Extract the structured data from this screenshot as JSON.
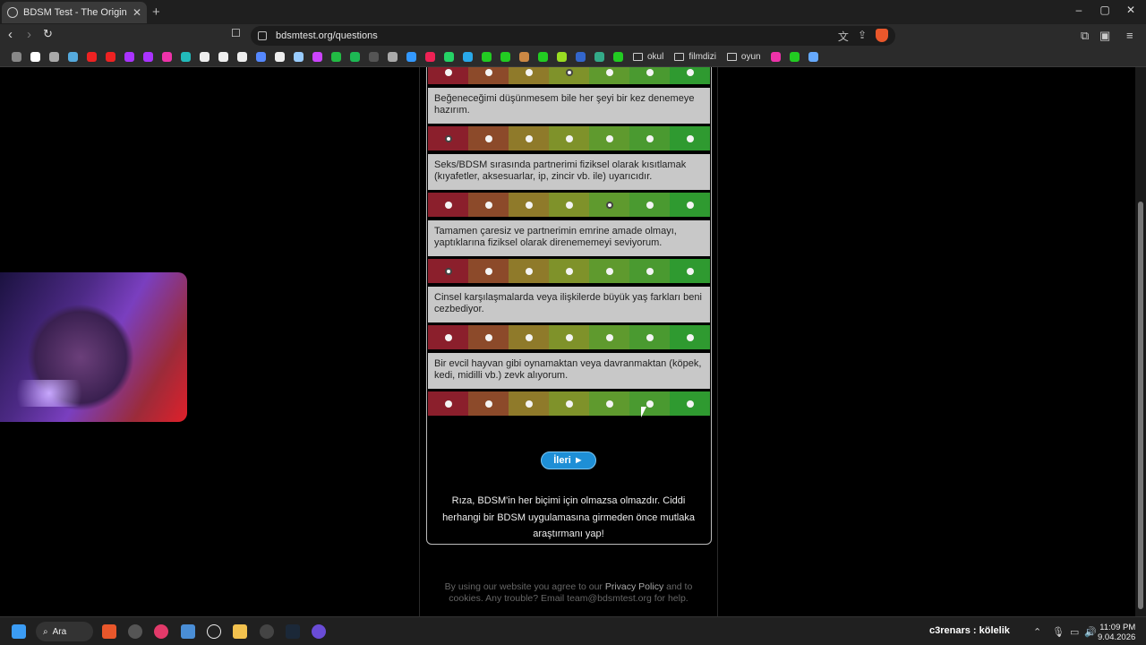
{
  "browser": {
    "tab_title": "BDSM Test - The Original BDSM",
    "new_tab": "+",
    "url": "bdsmtest.org/questions",
    "window_controls": [
      "–",
      "▢",
      "✕"
    ]
  },
  "bookmarks": {
    "folders": [
      "okul",
      "filmdizi",
      "oyun"
    ],
    "icon_colors": [
      "#888",
      "#fff",
      "#aaa",
      "#5ad",
      "#e22",
      "#e22",
      "#a3f",
      "#a3f",
      "#e3a",
      "#2bb",
      "#eee",
      "#eee",
      "#eee",
      "#58f",
      "#eee",
      "#9cf",
      "#c4f",
      "#2b4",
      "#1db954",
      "#555",
      "#aaa",
      "#39f",
      "#e25",
      "#25d366",
      "#29a9ea",
      "#2c2",
      "#2c2",
      "#c84",
      "#2c2",
      "#9d2",
      "#36c",
      "#3a8",
      "#2c2"
    ],
    "trailing_icon_colors": [
      "#e3a",
      "#2c2",
      "#6af"
    ]
  },
  "questions": [
    {
      "text": "",
      "selected": 3
    },
    {
      "text": "Beğeneceğimi düşünmesem bile her şeyi bir kez denemeye hazırım.",
      "selected": 0
    },
    {
      "text": "Seks/BDSM sırasında partnerimi fiziksel olarak kısıtlamak (kıyafetler, aksesuarlar, ip, zincir vb. ile) uyarıcıdır.",
      "selected": 4
    },
    {
      "text": "Tamamen çaresiz ve partnerimin emrine amade olmayı, yaptıklarına fiziksel olarak direnememeyi seviyorum.",
      "selected": 0
    },
    {
      "text": "Cinsel karşılaşmalarda veya ilişkilerde büyük yaş farkları beni cezbediyor.",
      "selected": null
    },
    {
      "text": "Bir evcil hayvan gibi oynamaktan veya davranmaktan (köpek, kedi, midilli vb.) zevk alıyorum.",
      "selected": null
    }
  ],
  "scale_colors": [
    "#8b1f2c",
    "#8c4a2a",
    "#8f7a2a",
    "#7f922a",
    "#5f9a2e",
    "#4a9a30",
    "#2f9a30"
  ],
  "next_button": "İleri ►",
  "consent_text": "Rıza, BDSM'in her biçimi için olmazsa olmazdır. Ciddi herhangi bir BDSM uygulamasına girmeden önce mutlaka araştırmanı yap!",
  "footer": {
    "pre": "By using our website you agree to our ",
    "link": "Privacy Policy",
    "post": " and to cookies. Any trouble? Email team@bdsmtest.org for help."
  },
  "taskbar": {
    "search_label": "Ara",
    "now_playing": "c3renars : kölelik",
    "time": "11:09 PM",
    "date": "9.04.2026"
  }
}
